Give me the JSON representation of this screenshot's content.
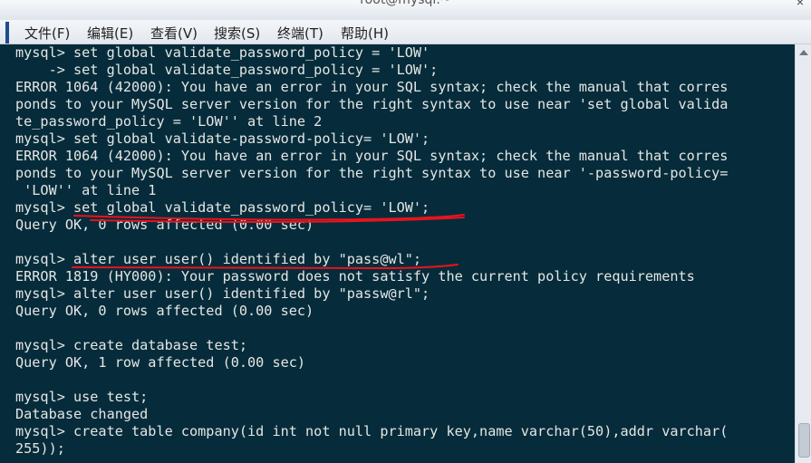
{
  "window": {
    "title": "root@mysql:~",
    "close_glyph": "×"
  },
  "menu": [
    {
      "label": "文件(F)"
    },
    {
      "label": "编辑(E)"
    },
    {
      "label": "查看(V)"
    },
    {
      "label": "搜索(S)"
    },
    {
      "label": "终端(T)"
    },
    {
      "label": "帮助(H)"
    }
  ],
  "terminal": {
    "lines": [
      "mysql> set global validate_password_policy = 'LOW'",
      "    -> set global validate_password_policy = 'LOW';",
      "ERROR 1064 (42000): You have an error in your SQL syntax; check the manual that corres",
      "ponds to your MySQL server version for the right syntax to use near 'set global valida",
      "te_password_policy = 'LOW'' at line 2",
      "mysql> set global validate-password-policy= 'LOW';",
      "ERROR 1064 (42000): You have an error in your SQL syntax; check the manual that corres",
      "ponds to your MySQL server version for the right syntax to use near '-password-policy=",
      " 'LOW'' at line 1",
      "mysql> set global validate_password_policy= 'LOW';",
      "Query OK, 0 rows affected (0.00 sec)",
      "",
      "mysql> alter user user() identified by \"pass@wl\";",
      "ERROR 1819 (HY000): Your password does not satisfy the current policy requirements",
      "mysql> alter user user() identified by \"passw@rl\";",
      "Query OK, 0 rows affected (0.00 sec)",
      "",
      "mysql> create database test;",
      "Query OK, 1 row affected (0.00 sec)",
      "",
      "mysql> use test;",
      "Database changed",
      "mysql> create table company(id int not null primary key,name varchar(50),addr varchar(",
      "255));"
    ]
  },
  "colors": {
    "terminal_bg": "#062c3b",
    "terminal_fg": "#e4e6e4",
    "underline_mark": "#e8131d"
  }
}
